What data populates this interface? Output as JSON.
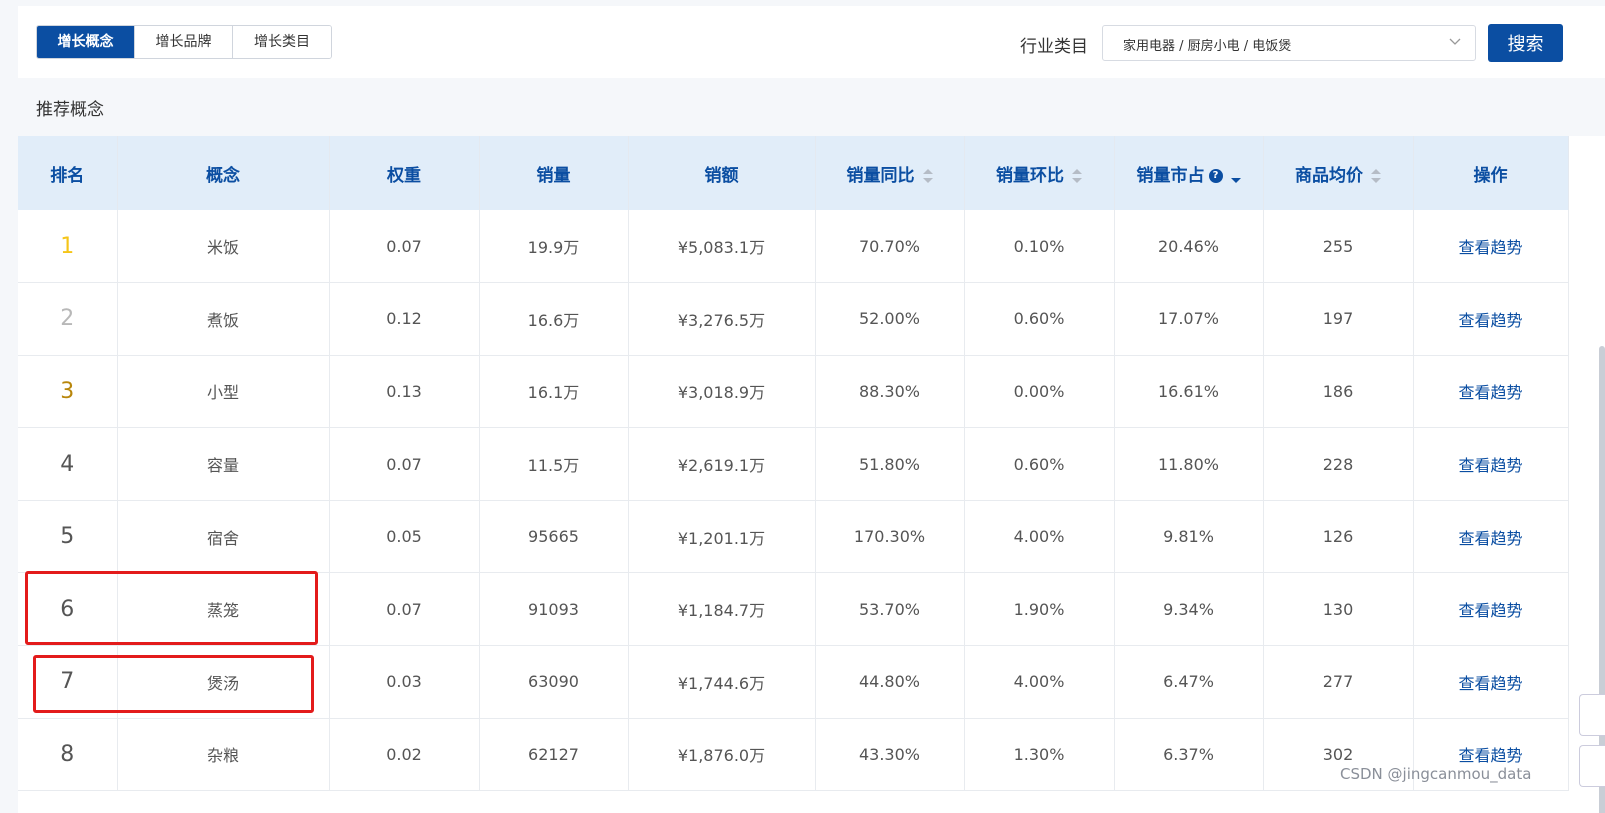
{
  "tabs": [
    {
      "label": "增长概念",
      "active": true
    },
    {
      "label": "增长品牌",
      "active": false
    },
    {
      "label": "增长类目",
      "active": false
    }
  ],
  "filter": {
    "label": "行业类目",
    "value": "家用电器 / 厨房小电 / 电饭煲"
  },
  "search_label": "搜索",
  "section_title": "推荐概念",
  "columns": {
    "rank": "排名",
    "concept": "概念",
    "weight": "权重",
    "sales": "销量",
    "revenue": "销额",
    "yoy": "销量同比",
    "mom": "销量环比",
    "share": "销量市占",
    "avg_price": "商品均价",
    "action": "操作"
  },
  "rows": [
    {
      "rank": "1",
      "concept": "米饭",
      "weight": "0.07",
      "sales": "19.9万",
      "revenue": "¥5,083.1万",
      "yoy": "70.70%",
      "mom": "0.10%",
      "share": "20.46%",
      "avg_price": "255",
      "action": "查看趋势"
    },
    {
      "rank": "2",
      "concept": "煮饭",
      "weight": "0.12",
      "sales": "16.6万",
      "revenue": "¥3,276.5万",
      "yoy": "52.00%",
      "mom": "0.60%",
      "share": "17.07%",
      "avg_price": "197",
      "action": "查看趋势"
    },
    {
      "rank": "3",
      "concept": "小型",
      "weight": "0.13",
      "sales": "16.1万",
      "revenue": "¥3,018.9万",
      "yoy": "88.30%",
      "mom": "0.00%",
      "share": "16.61%",
      "avg_price": "186",
      "action": "查看趋势"
    },
    {
      "rank": "4",
      "concept": "容量",
      "weight": "0.07",
      "sales": "11.5万",
      "revenue": "¥2,619.1万",
      "yoy": "51.80%",
      "mom": "0.60%",
      "share": "11.80%",
      "avg_price": "228",
      "action": "查看趋势"
    },
    {
      "rank": "5",
      "concept": "宿舍",
      "weight": "0.05",
      "sales": "95665",
      "revenue": "¥1,201.1万",
      "yoy": "170.30%",
      "mom": "4.00%",
      "share": "9.81%",
      "avg_price": "126",
      "action": "查看趋势"
    },
    {
      "rank": "6",
      "concept": "蒸笼",
      "weight": "0.07",
      "sales": "91093",
      "revenue": "¥1,184.7万",
      "yoy": "53.70%",
      "mom": "1.90%",
      "share": "9.34%",
      "avg_price": "130",
      "action": "查看趋势"
    },
    {
      "rank": "7",
      "concept": "煲汤",
      "weight": "0.03",
      "sales": "63090",
      "revenue": "¥1,744.6万",
      "yoy": "44.80%",
      "mom": "4.00%",
      "share": "6.47%",
      "avg_price": "277",
      "action": "查看趋势"
    },
    {
      "rank": "8",
      "concept": "杂粮",
      "weight": "0.02",
      "sales": "62127",
      "revenue": "¥1,876.0万",
      "yoy": "43.30%",
      "mom": "1.30%",
      "share": "6.37%",
      "avg_price": "302",
      "action": "查看趋势"
    }
  ],
  "help_glyph": "?",
  "watermark": "CSDN @jingcanmou_data",
  "colors": {
    "primary": "#0b4ea2",
    "header_bg": "#e1edf9",
    "rank_gold": "#f5c518",
    "rank_silver": "#b8b8b8",
    "rank_bronze": "#b8860b",
    "highlight": "#e31b1b"
  }
}
